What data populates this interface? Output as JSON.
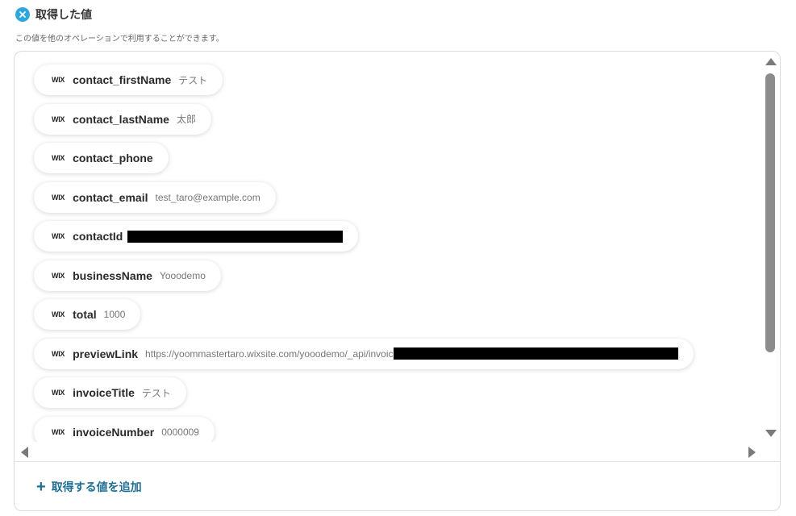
{
  "header": {
    "title": "取得した値",
    "icon": "close-badge-icon",
    "icon_color": "#2ea7dc"
  },
  "subtitle": "この値を他のオペレーションで利用することができます。",
  "fields": [
    {
      "source": "WIX",
      "key": "contact_firstName",
      "value": "テスト",
      "redacted": false
    },
    {
      "source": "WIX",
      "key": "contact_lastName",
      "value": "太郎",
      "redacted": false
    },
    {
      "source": "WIX",
      "key": "contact_phone",
      "value": "",
      "redacted": false
    },
    {
      "source": "WIX",
      "key": "contact_email",
      "value": "test_taro@example.com",
      "redacted": false
    },
    {
      "source": "WIX",
      "key": "contactId",
      "value": "",
      "redacted": true
    },
    {
      "source": "WIX",
      "key": "businessName",
      "value": "Yooodemo",
      "redacted": false
    },
    {
      "source": "WIX",
      "key": "total",
      "value": "1000",
      "redacted": false
    },
    {
      "source": "WIX",
      "key": "previewLink",
      "value": "https://yoommastertaro.wixsite.com/yooodemo/_api/invoic",
      "redacted": true
    },
    {
      "source": "WIX",
      "key": "invoiceTitle",
      "value": "テスト",
      "redacted": false
    },
    {
      "source": "WIX",
      "key": "invoiceNumber",
      "value": "0000009",
      "redacted": false
    }
  ],
  "add_button": {
    "label": "取得する値を追加",
    "color": "#1f6f93"
  }
}
